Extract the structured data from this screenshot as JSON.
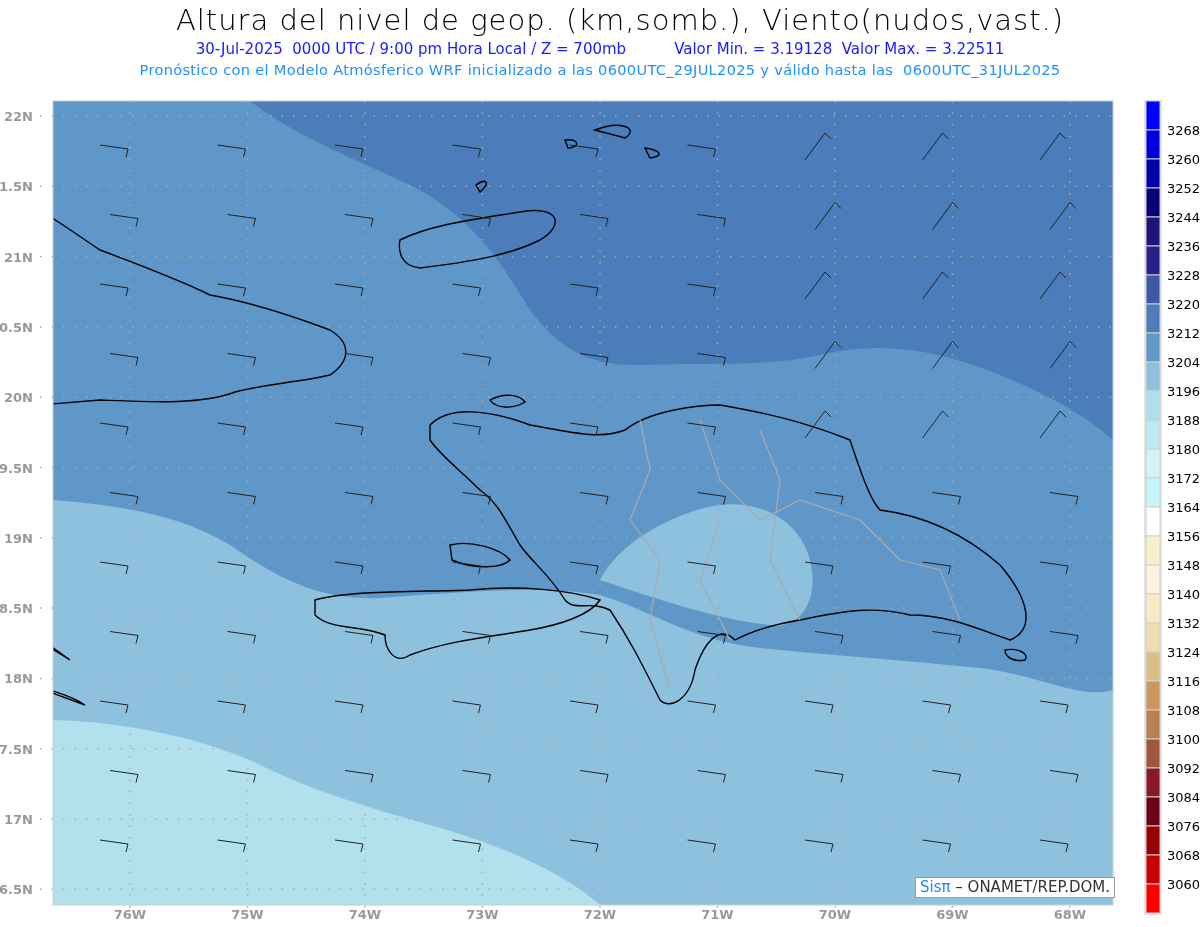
{
  "title": "Altura del nivel de geop. (km,somb.), Viento(nudos,vast.)",
  "subtitle": [
    "30-Jul-2025  0000 UTC / 9:00 pm Hora Local / Z = 700mb",
    "Valor Min. = 3.19128  Valor Max. = 3.22511"
  ],
  "note": "Pronóstico con el Modelo Atmósferico WRF inicializado a las 0600UTC_29JUL2025 y válido hasta las  0600UTC_31JUL2025",
  "map": {
    "bands": [
      {
        "color": "#5f97c9"
      },
      {
        "color": "#4a7db9"
      },
      {
        "color": "#8ec1de"
      },
      {
        "color": "#b2e0ed"
      }
    ],
    "lat_ticks": [
      "22N",
      "1.5N",
      "21N",
      "0.5N",
      "20N",
      "9.5N",
      "19N",
      "8.5N",
      "18N",
      "7.5N",
      "17N",
      "6.5N"
    ],
    "lon_ticks": [
      "76W",
      "75W",
      "74W",
      "73W",
      "72W",
      "71W",
      "70W",
      "69W",
      "68W"
    ]
  },
  "credit": {
    "brand": "Sisπ",
    "text": "– ONAMET/REP.DOM."
  },
  "colorbar": {
    "swatches": [
      {
        "color": "#0000ff"
      },
      {
        "color": "#0000dc"
      },
      {
        "color": "#0000aa"
      },
      {
        "color": "#0a0078"
      },
      {
        "color": "#1e1478"
      },
      {
        "color": "#282088"
      },
      {
        "color": "#3c58a6"
      },
      {
        "color": "#4a7db9"
      },
      {
        "color": "#5f97c9"
      },
      {
        "color": "#8ec1de"
      },
      {
        "color": "#aedfec"
      },
      {
        "color": "#bde9f3"
      },
      {
        "color": "#d4f2f8"
      },
      {
        "color": "#c6f6fb"
      },
      {
        "color": "#ffffff"
      },
      {
        "color": "#f8f0c8"
      },
      {
        "color": "#fbf3e2"
      },
      {
        "color": "#f7ebc3"
      },
      {
        "color": "#eedcb2"
      },
      {
        "color": "#dcbe8a"
      },
      {
        "color": "#c8985e"
      },
      {
        "color": "#bb7e50"
      },
      {
        "color": "#a0573d"
      },
      {
        "color": "#881a28"
      },
      {
        "color": "#6c0016"
      },
      {
        "color": "#960000"
      },
      {
        "color": "#c80000"
      },
      {
        "color": "#ff0000"
      }
    ],
    "labels": [
      "3268",
      "3260",
      "3252",
      "3244",
      "3236",
      "3228",
      "3220",
      "3212",
      "3204",
      "3196",
      "3188",
      "3180",
      "3172",
      "3164",
      "3156",
      "3148",
      "3140",
      "3132",
      "3124",
      "3116",
      "3108",
      "3100",
      "3092",
      "3084",
      "3076",
      "3068",
      "3060"
    ]
  }
}
